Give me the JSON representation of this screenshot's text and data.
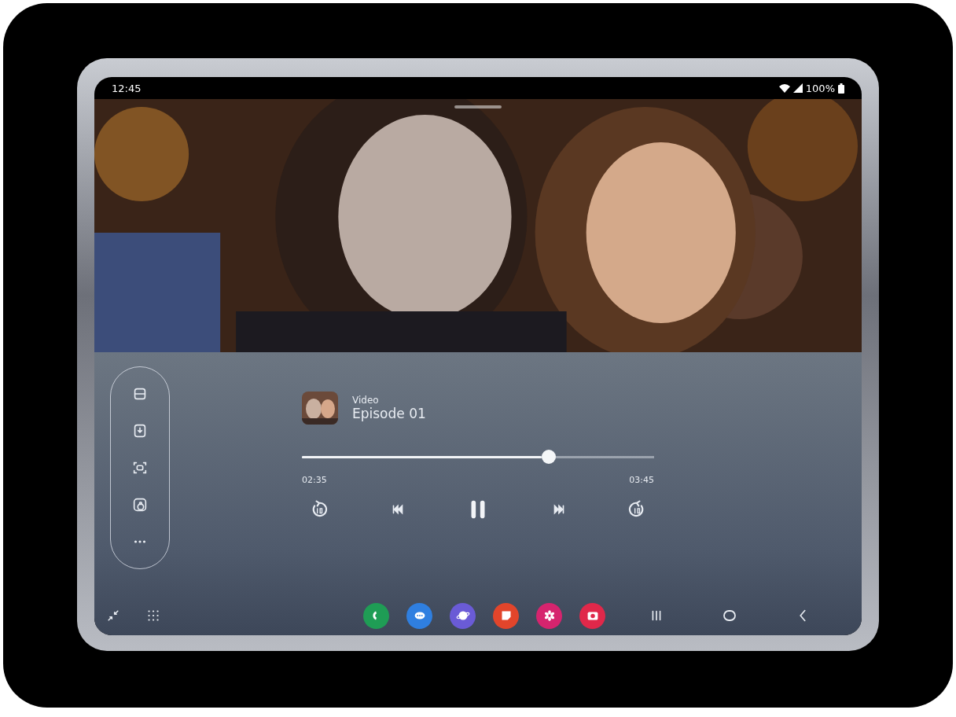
{
  "status_bar": {
    "time": "12:45",
    "battery": "100%"
  },
  "now_playing": {
    "label": "Video",
    "title": "Episode 01",
    "playing": true
  },
  "progress": {
    "level": 0.7,
    "elapsed": "02:35",
    "total": "03:45"
  },
  "dock": [
    {
      "kind": "phone",
      "color": "#1f9d55"
    },
    {
      "kind": "messages",
      "color": "#2f7fe0"
    },
    {
      "kind": "browser",
      "color": "#6a5bd6"
    },
    {
      "kind": "notes",
      "color": "#e2452b"
    },
    {
      "kind": "flower",
      "color": "#d6246e"
    },
    {
      "kind": "camera",
      "color": "#e0284a"
    }
  ]
}
